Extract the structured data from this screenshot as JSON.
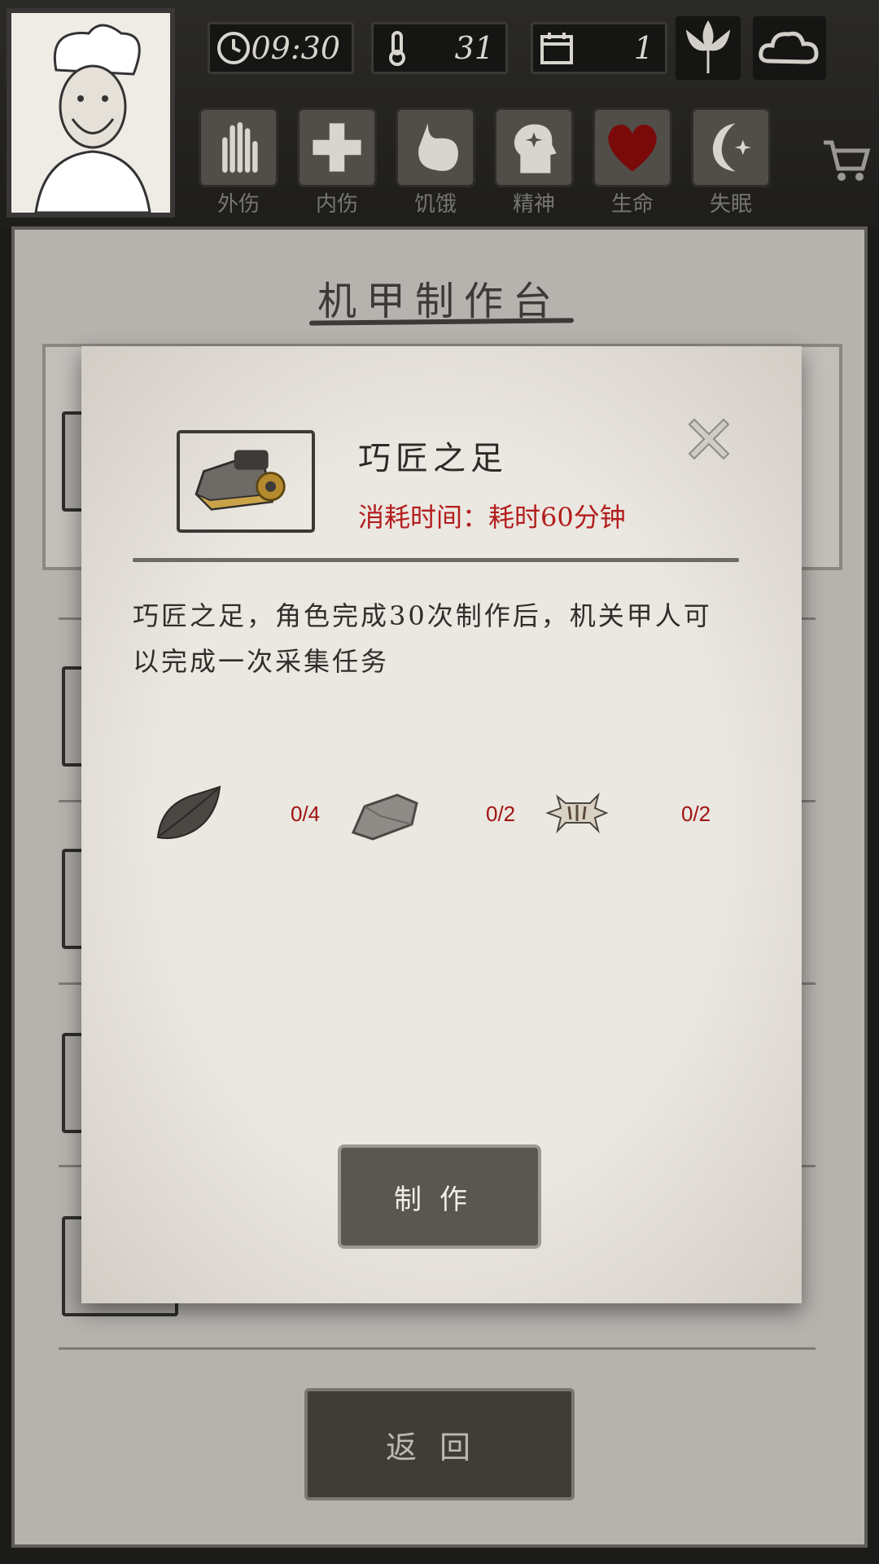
{
  "hud": {
    "time": "09:30",
    "temperature": "31",
    "day": "1",
    "status_labels": [
      "外伤",
      "内伤",
      "饥饿",
      "精神",
      "生命",
      "失眠"
    ]
  },
  "panel": {
    "title": "机甲制作台",
    "back_label": "返回"
  },
  "dialog": {
    "item_name": "巧匠之足",
    "time_cost": "消耗时间：耗时60分钟",
    "description": "巧匠之足，角色完成30次制作后，机关甲人可以完成一次采集任务",
    "materials": [
      {
        "icon": "leaf-icon",
        "count": "0/4"
      },
      {
        "icon": "stone-icon",
        "count": "0/2"
      },
      {
        "icon": "animal-hide-icon",
        "count": "0/2"
      }
    ],
    "make_label": "制作"
  },
  "colors": {
    "time_cost": "#b31d1d",
    "material_count": "#a11313",
    "health_heart": "#7a0a0a"
  }
}
